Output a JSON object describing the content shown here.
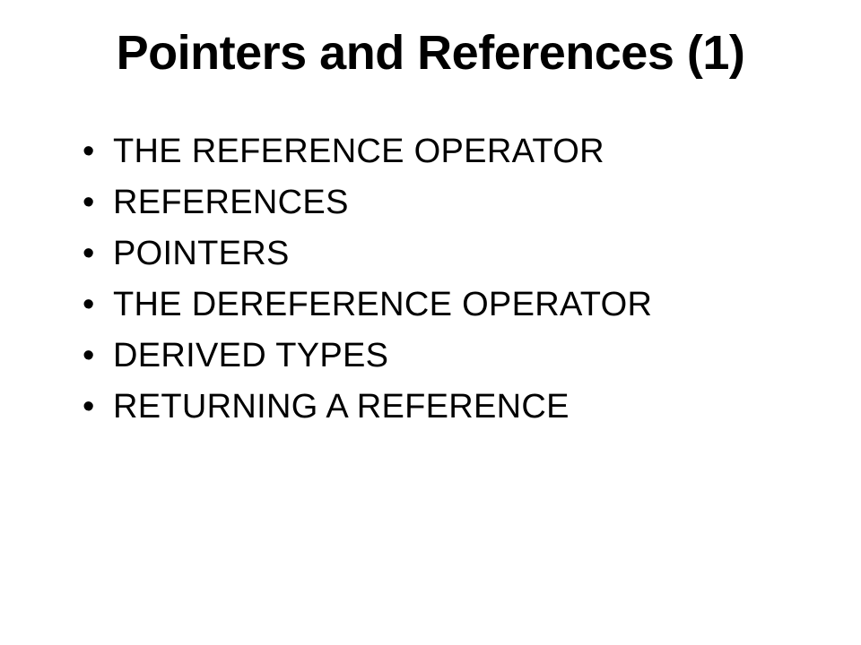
{
  "slide": {
    "title": "Pointers and References (1)",
    "bullets": [
      "THE REFERENCE OPERATOR",
      "REFERENCES",
      "POINTERS",
      "THE DEREFERENCE OPERATOR",
      "DERIVED TYPES",
      "RETURNING A REFERENCE"
    ]
  }
}
